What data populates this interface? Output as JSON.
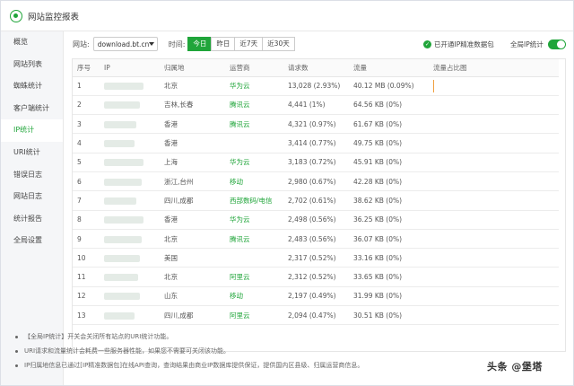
{
  "app": {
    "title": "网站监控报表"
  },
  "sidebar": {
    "items": [
      {
        "label": "概览"
      },
      {
        "label": "网站列表"
      },
      {
        "label": "蜘蛛统计"
      },
      {
        "label": "客户端统计"
      },
      {
        "label": "IP统计",
        "active": true
      },
      {
        "label": "URI统计"
      },
      {
        "label": "错误日志"
      },
      {
        "label": "网站日志"
      },
      {
        "label": "统计报告"
      },
      {
        "label": "全局设置"
      }
    ]
  },
  "toolbar": {
    "site_label": "网站:",
    "site_value": "download.bt.cn",
    "time_label": "时间:",
    "time_tabs": [
      "今日",
      "昨日",
      "近7天",
      "近30天"
    ],
    "active_time_tab": 0,
    "precise_label": "已开通IP精准数据包",
    "global_label": "全局IP统计",
    "global_enabled": true
  },
  "table": {
    "columns": [
      "序号",
      "IP",
      "归属地",
      "运营商",
      "请求数",
      "流量",
      "流量占比图"
    ],
    "rows": [
      {
        "no": "1",
        "location": "北京",
        "isp": "华为云",
        "requests": "13,028 (2.93%)",
        "traffic": "40.12 MB (0.09%)",
        "ratio": 0.09
      },
      {
        "no": "2",
        "location": "吉林,长春",
        "isp": "腾讯云",
        "requests": "4,441 (1%)",
        "traffic": "64.56 KB (0%)",
        "ratio": 0
      },
      {
        "no": "3",
        "location": "香港",
        "isp": "腾讯云",
        "requests": "4,321 (0.97%)",
        "traffic": "61.67 KB (0%)",
        "ratio": 0
      },
      {
        "no": "4",
        "location": "香港",
        "isp": "",
        "requests": "3,414 (0.77%)",
        "traffic": "49.75 KB (0%)",
        "ratio": 0
      },
      {
        "no": "5",
        "location": "上海",
        "isp": "华为云",
        "requests": "3,183 (0.72%)",
        "traffic": "45.91 KB (0%)",
        "ratio": 0
      },
      {
        "no": "6",
        "location": "浙江,台州",
        "isp": "移动",
        "requests": "2,980 (0.67%)",
        "traffic": "42.28 KB (0%)",
        "ratio": 0
      },
      {
        "no": "7",
        "location": "四川,成都",
        "isp": "西部数码/电信",
        "requests": "2,702 (0.61%)",
        "traffic": "38.62 KB (0%)",
        "ratio": 0
      },
      {
        "no": "8",
        "location": "香港",
        "isp": "华为云",
        "requests": "2,498 (0.56%)",
        "traffic": "36.25 KB (0%)",
        "ratio": 0
      },
      {
        "no": "9",
        "location": "北京",
        "isp": "腾讯云",
        "requests": "2,483 (0.56%)",
        "traffic": "36.07 KB (0%)",
        "ratio": 0
      },
      {
        "no": "10",
        "location": "美国",
        "isp": "",
        "requests": "2,317 (0.52%)",
        "traffic": "33.16 KB (0%)",
        "ratio": 0
      },
      {
        "no": "11",
        "location": "北京",
        "isp": "阿里云",
        "requests": "2,312 (0.52%)",
        "traffic": "33.65 KB (0%)",
        "ratio": 0
      },
      {
        "no": "12",
        "location": "山东",
        "isp": "移动",
        "requests": "2,197 (0.49%)",
        "traffic": "31.99 KB (0%)",
        "ratio": 0
      },
      {
        "no": "13",
        "location": "四川,成都",
        "isp": "阿里云",
        "requests": "2,094 (0.47%)",
        "traffic": "30.51 KB (0%)",
        "ratio": 0
      }
    ]
  },
  "notes": [
    "【全局IP统计】开关会关闭所有站点的URI统计功能。",
    "URI请求和流量统计会耗费一些服务器性能，如果您不需要可关闭该功能。",
    "IP归属地信息已通过[IP精准数据包]在线API查询，查询结果由商业IP数据库提供保证，提供国内区县级、归属运营商信息。"
  ],
  "watermark": "头条 @堡塔",
  "colors": {
    "accent": "#20a53a",
    "ratio_marker": "#f0a040"
  }
}
